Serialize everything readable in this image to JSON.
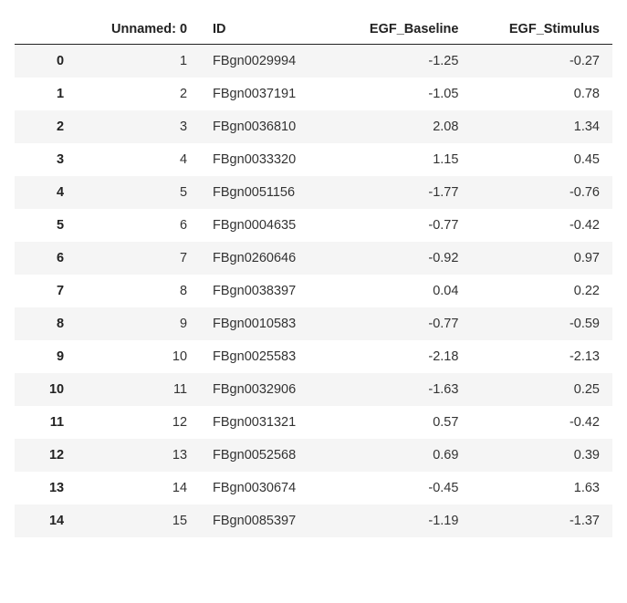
{
  "columns": {
    "index": "",
    "unnamed": "Unnamed: 0",
    "id": "ID",
    "baseline": "EGF_Baseline",
    "stimulus": "EGF_Stimulus"
  },
  "rows": [
    {
      "idx": "0",
      "unnamed": "1",
      "id": "FBgn0029994",
      "baseline": "-1.25",
      "stimulus": "-0.27"
    },
    {
      "idx": "1",
      "unnamed": "2",
      "id": "FBgn0037191",
      "baseline": "-1.05",
      "stimulus": "0.78"
    },
    {
      "idx": "2",
      "unnamed": "3",
      "id": "FBgn0036810",
      "baseline": "2.08",
      "stimulus": "1.34"
    },
    {
      "idx": "3",
      "unnamed": "4",
      "id": "FBgn0033320",
      "baseline": "1.15",
      "stimulus": "0.45"
    },
    {
      "idx": "4",
      "unnamed": "5",
      "id": "FBgn0051156",
      "baseline": "-1.77",
      "stimulus": "-0.76"
    },
    {
      "idx": "5",
      "unnamed": "6",
      "id": "FBgn0004635",
      "baseline": "-0.77",
      "stimulus": "-0.42"
    },
    {
      "idx": "6",
      "unnamed": "7",
      "id": "FBgn0260646",
      "baseline": "-0.92",
      "stimulus": "0.97"
    },
    {
      "idx": "7",
      "unnamed": "8",
      "id": "FBgn0038397",
      "baseline": "0.04",
      "stimulus": "0.22"
    },
    {
      "idx": "8",
      "unnamed": "9",
      "id": "FBgn0010583",
      "baseline": "-0.77",
      "stimulus": "-0.59"
    },
    {
      "idx": "9",
      "unnamed": "10",
      "id": "FBgn0025583",
      "baseline": "-2.18",
      "stimulus": "-2.13"
    },
    {
      "idx": "10",
      "unnamed": "11",
      "id": "FBgn0032906",
      "baseline": "-1.63",
      "stimulus": "0.25"
    },
    {
      "idx": "11",
      "unnamed": "12",
      "id": "FBgn0031321",
      "baseline": "0.57",
      "stimulus": "-0.42"
    },
    {
      "idx": "12",
      "unnamed": "13",
      "id": "FBgn0052568",
      "baseline": "0.69",
      "stimulus": "0.39"
    },
    {
      "idx": "13",
      "unnamed": "14",
      "id": "FBgn0030674",
      "baseline": "-0.45",
      "stimulus": "1.63"
    },
    {
      "idx": "14",
      "unnamed": "15",
      "id": "FBgn0085397",
      "baseline": "-1.19",
      "stimulus": "-1.37"
    }
  ]
}
